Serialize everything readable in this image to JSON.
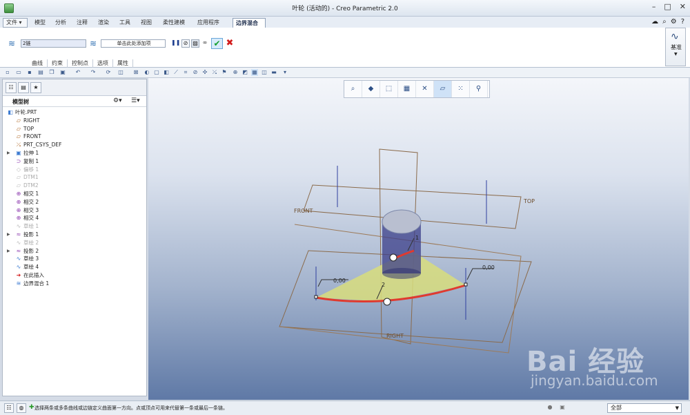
{
  "window": {
    "title": "叶轮 (活动的) - Creo Parametric 2.0",
    "controls": [
      "–",
      "□",
      "✕"
    ]
  },
  "menu_tabs": [
    "文件",
    "模型",
    "分析",
    "注释",
    "渲染",
    "工具",
    "视图",
    "柔性建模",
    "应用程序",
    "边界混合"
  ],
  "active_tab": "边界混合",
  "ribbon": {
    "first_direction_value": "2链",
    "second_direction_placeholder": "单击此处添加项",
    "subtabs": [
      "曲线",
      "约束",
      "控制点",
      "选项",
      "属性"
    ],
    "datum_group_label": "基准"
  },
  "left_panel": {
    "title": "模型树",
    "tree": [
      {
        "label": "叶轮.PRT",
        "icon": "part-icon",
        "level": 0,
        "expandable": false,
        "suppressed": false
      },
      {
        "label": "RIGHT",
        "icon": "datum-plane-icon",
        "level": 1,
        "expandable": false,
        "suppressed": false
      },
      {
        "label": "TOP",
        "icon": "datum-plane-icon",
        "level": 1,
        "expandable": false,
        "suppressed": false
      },
      {
        "label": "FRONT",
        "icon": "datum-plane-icon",
        "level": 1,
        "expandable": false,
        "suppressed": false
      },
      {
        "label": "PRT_CSYS_DEF",
        "icon": "csys-icon",
        "level": 1,
        "expandable": false,
        "suppressed": false
      },
      {
        "label": "拉伸 1",
        "icon": "extrude-icon",
        "level": 1,
        "expandable": true,
        "suppressed": false
      },
      {
        "label": "复制 1",
        "icon": "copy-icon",
        "level": 1,
        "expandable": false,
        "suppressed": false
      },
      {
        "label": "偏移 1",
        "icon": "offset-icon",
        "level": 1,
        "expandable": false,
        "suppressed": true
      },
      {
        "label": "DTM1",
        "icon": "datum-plane-icon",
        "level": 1,
        "expandable": false,
        "suppressed": true
      },
      {
        "label": "DTM2",
        "icon": "datum-plane-icon",
        "level": 1,
        "expandable": false,
        "suppressed": true
      },
      {
        "label": "相交 1",
        "icon": "intersect-icon",
        "level": 1,
        "expandable": false,
        "suppressed": false
      },
      {
        "label": "相交 2",
        "icon": "intersect-icon",
        "level": 1,
        "expandable": false,
        "suppressed": false
      },
      {
        "label": "相交 3",
        "icon": "intersect-icon",
        "level": 1,
        "expandable": false,
        "suppressed": false
      },
      {
        "label": "相交 4",
        "icon": "intersect-icon",
        "level": 1,
        "expandable": false,
        "suppressed": false
      },
      {
        "label": "草绘 1",
        "icon": "sketch-icon",
        "level": 1,
        "expandable": false,
        "suppressed": true
      },
      {
        "label": "投影 1",
        "icon": "projection-icon",
        "level": 1,
        "expandable": true,
        "suppressed": false
      },
      {
        "label": "草绘 2",
        "icon": "sketch-icon",
        "level": 1,
        "expandable": false,
        "suppressed": true
      },
      {
        "label": "投影 2",
        "icon": "projection-icon",
        "level": 1,
        "expandable": true,
        "suppressed": false
      },
      {
        "label": "草绘 3",
        "icon": "sketch-icon",
        "level": 1,
        "expandable": false,
        "suppressed": false
      },
      {
        "label": "草绘 4",
        "icon": "sketch-icon",
        "level": 1,
        "expandable": false,
        "suppressed": false
      },
      {
        "label": "在此插入",
        "icon": "insert-arrow-icon",
        "level": 1,
        "expandable": false,
        "suppressed": false
      },
      {
        "label": "边界混合 1",
        "icon": "boundary-blend-icon",
        "level": 1,
        "expandable": false,
        "suppressed": false
      }
    ]
  },
  "viewport": {
    "labels": {
      "front": "FRONT",
      "top": "TOP",
      "right": "RIGHT",
      "dim_left": "0,00",
      "dim_right": "0,00",
      "chain_1": "1",
      "chain_2": "2"
    },
    "colors": {
      "boundary_curve": "#e03a2e",
      "surface_fill": "#d8dd7c",
      "datum_plane": "#8a6a4a",
      "axis_lines": "#2f3f9f"
    }
  },
  "watermark": {
    "main": "Bai 经验",
    "sub": "jingyan.baidu.com"
  },
  "statusbar": {
    "message": "选择两条或多条曲线或边链定义曲面第一方向。点或顶点可用来代替第一条或最后一条链。",
    "filter_value": "全部"
  }
}
